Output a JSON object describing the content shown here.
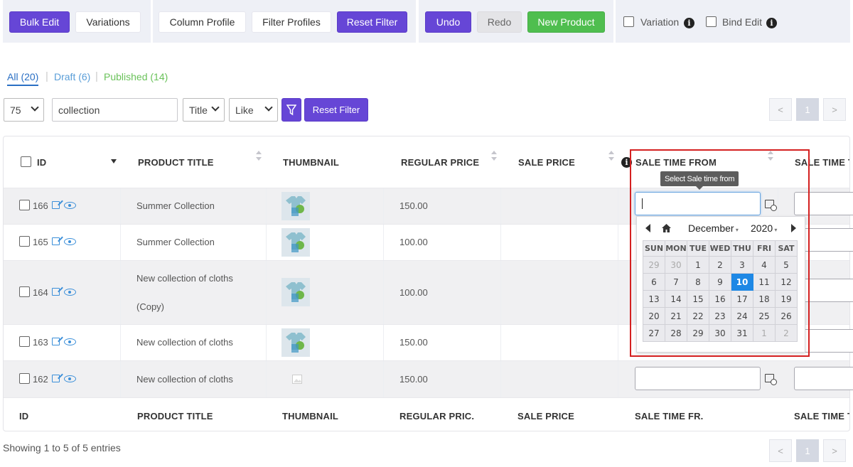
{
  "toolbar": {
    "bulk_edit": "Bulk Edit",
    "variations": "Variations",
    "column_profile": "Column Profile",
    "filter_profiles": "Filter Profiles",
    "reset_filter": "Reset Filter",
    "undo": "Undo",
    "redo": "Redo",
    "new_product": "New Product",
    "variation_label": "Variation",
    "bind_edit_label": "Bind Edit"
  },
  "status_tabs": {
    "all": "All (20)",
    "draft": "Draft (6)",
    "published": "Published (14)"
  },
  "filters": {
    "per_page": "75",
    "search_value": "collection",
    "field": "Title",
    "operator": "Like",
    "reset_filter": "Reset Filter"
  },
  "pagination": {
    "prev": "<",
    "current": "1",
    "next": ">"
  },
  "table": {
    "headers": [
      "ID",
      "PRODUCT TITLE",
      "THUMBNAIL",
      "REGULAR PRICE",
      "SALE PRICE",
      "SALE TIME FROM",
      "SALE TIME T"
    ],
    "footers": [
      "ID",
      "PRODUCT TITLE",
      "THUMBNAIL",
      "REGULAR PRIC.",
      "SALE PRICE",
      "SALE TIME FR.",
      "SALE TIME T"
    ],
    "rows": [
      {
        "id": "166",
        "title": "Summer Collection",
        "title2": "",
        "price": "150.00",
        "thumb": "tshirt"
      },
      {
        "id": "165",
        "title": "Summer Collection",
        "title2": "",
        "price": "100.00",
        "thumb": "tshirt"
      },
      {
        "id": "164",
        "title": "New collection of cloths",
        "title2": "(Copy)",
        "price": "100.00",
        "thumb": "tshirt"
      },
      {
        "id": "163",
        "title": "New collection of cloths",
        "title2": "",
        "price": "150.00",
        "thumb": "tshirt"
      },
      {
        "id": "162",
        "title": "New collection of cloths",
        "title2": "",
        "price": "150.00",
        "thumb": "placeholder"
      }
    ]
  },
  "tooltip": "Select Sale time from",
  "datepicker": {
    "month": "December",
    "year": "2020",
    "weekdays": [
      "SUN",
      "MON",
      "TUE",
      "WED",
      "THU",
      "FRI",
      "SAT"
    ],
    "weeks": [
      [
        "29",
        "30",
        "1",
        "2",
        "3",
        "4",
        "5"
      ],
      [
        "6",
        "7",
        "8",
        "9",
        "10",
        "11",
        "12"
      ],
      [
        "13",
        "14",
        "15",
        "16",
        "17",
        "18",
        "19"
      ],
      [
        "20",
        "21",
        "22",
        "23",
        "24",
        "25",
        "26"
      ],
      [
        "27",
        "28",
        "29",
        "30",
        "31",
        "1",
        "2"
      ]
    ],
    "selected": "10"
  },
  "footer_text": "Showing 1 to 5 of 5 entries",
  "colors": {
    "accent": "#6646d6",
    "green": "#4fbe4f",
    "link": "#3b8fd9",
    "highlight": "#d42020"
  }
}
